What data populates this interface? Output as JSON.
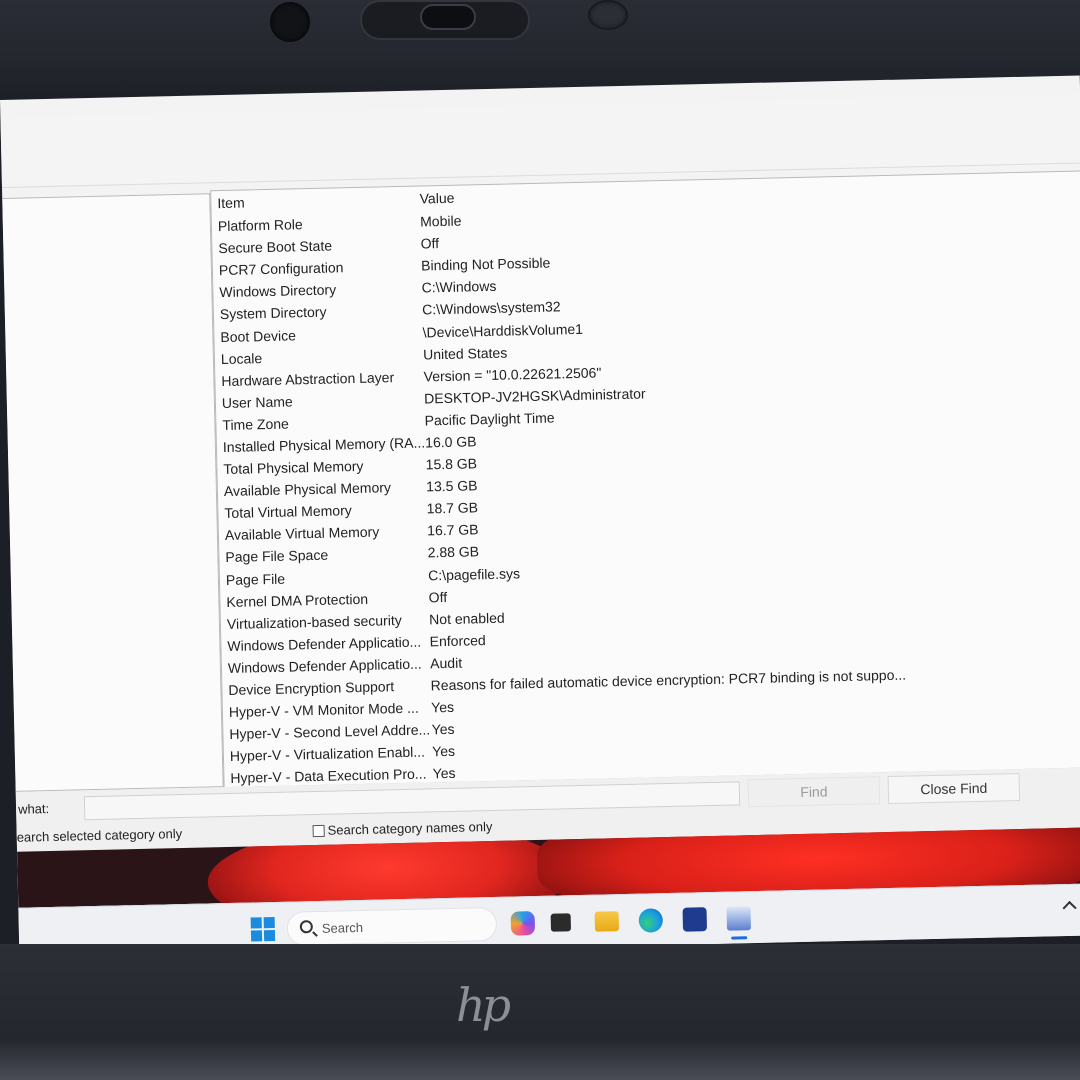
{
  "list": {
    "header": {
      "item": "Item",
      "value": "Value"
    },
    "rows": [
      {
        "item": "Platform Role",
        "value": "Mobile"
      },
      {
        "item": "Secure Boot State",
        "value": "Off"
      },
      {
        "item": "PCR7 Configuration",
        "value": "Binding Not Possible"
      },
      {
        "item": "Windows Directory",
        "value": "C:\\Windows"
      },
      {
        "item": "System Directory",
        "value": "C:\\Windows\\system32"
      },
      {
        "item": "Boot Device",
        "value": "\\Device\\HarddiskVolume1"
      },
      {
        "item": "Locale",
        "value": "United States"
      },
      {
        "item": "Hardware Abstraction Layer",
        "value": "Version = \"10.0.22621.2506\""
      },
      {
        "item": "User Name",
        "value": "DESKTOP-JV2HGSK\\Administrator"
      },
      {
        "item": "Time Zone",
        "value": "Pacific Daylight Time"
      },
      {
        "item": "Installed Physical Memory (RA...",
        "value": "16.0 GB"
      },
      {
        "item": "Total Physical Memory",
        "value": "15.8 GB"
      },
      {
        "item": "Available Physical Memory",
        "value": "13.5 GB"
      },
      {
        "item": "Total Virtual Memory",
        "value": "18.7 GB"
      },
      {
        "item": "Available Virtual Memory",
        "value": "16.7 GB"
      },
      {
        "item": "Page File Space",
        "value": "2.88 GB"
      },
      {
        "item": "Page File",
        "value": "C:\\pagefile.sys"
      },
      {
        "item": "Kernel DMA Protection",
        "value": "Off"
      },
      {
        "item": "Virtualization-based security",
        "value": "Not enabled"
      },
      {
        "item": "Windows Defender Applicatio...",
        "value": "Enforced"
      },
      {
        "item": "Windows Defender Applicatio...",
        "value": "Audit"
      },
      {
        "item": "Device Encryption Support",
        "value": "Reasons for failed automatic device encryption: PCR7 binding is not suppo..."
      },
      {
        "item": "Hyper-V - VM Monitor Mode ...",
        "value": "Yes"
      },
      {
        "item": "Hyper-V - Second Level Addre...",
        "value": "Yes"
      },
      {
        "item": "Hyper-V - Virtualization Enabl...",
        "value": "Yes"
      },
      {
        "item": "Hyper-V - Data Execution Pro...",
        "value": "Yes"
      }
    ]
  },
  "find": {
    "label": "what:",
    "input_value": "",
    "find_button": "Find",
    "close_button": "Close Find",
    "search_selected_label": "earch selected category only",
    "search_names_label": "Search category names only"
  },
  "taskbar": {
    "search_text": "Search",
    "icons": [
      "windows-start-icon",
      "search-icon",
      "copilot-icon",
      "task-view-icon",
      "file-explorer-icon",
      "edge-icon",
      "store-icon",
      "system-information-icon",
      "chevron-up-icon"
    ]
  },
  "brand": {
    "logo_text": "hp"
  },
  "colors": {
    "accent": "#1b8be0",
    "wallpaper_red": "#e0261f"
  }
}
